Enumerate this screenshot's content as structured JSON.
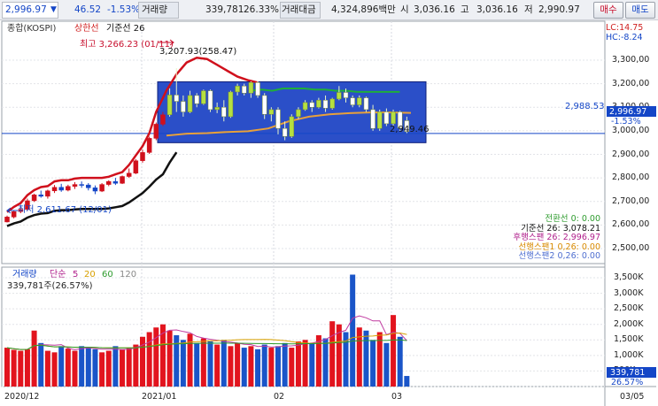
{
  "quote_bar": {
    "current": "2,996.97",
    "arrow": "▼",
    "change": "46.52",
    "change_pct": "-1.53%",
    "volume_label": "거래량",
    "volume": "339,781",
    "volume_ratio": "26.33%",
    "amount_label": "거래대금",
    "amount": "4,324,896백만",
    "open_label": "시",
    "open": "3,036.16",
    "high_label": "고",
    "high": "3,036.16",
    "low_label": "저",
    "low": "2,990.97",
    "buy_label": "매수",
    "sell_label": "매도"
  },
  "price_panel": {
    "title": "종합(KOSPI)",
    "indicator1": "상한선",
    "indicator2": "기준선 26",
    "lc": "LC:14.75",
    "hc": "HC:-8.24",
    "high_note": "최고 3,266.23 (01/11)",
    "low_note": "최저 2,611.67 (12/01)",
    "box_high": "3,207.93(258.47)",
    "box_low": "2,949.46",
    "ref_line": "2,988.53",
    "current_tag": "2,996.97",
    "current_pct": "-1.53%",
    "y_ticks": [
      "3,300,00",
      "3,200,00",
      "3,100,00",
      "3,000,00",
      "2,900,00",
      "2,800,00",
      "2,700,00",
      "2,600,00",
      "2,500,00"
    ]
  },
  "legend": [
    {
      "text": "전환선 0: 0.00",
      "color": "#2e9b2e"
    },
    {
      "text": "기준선 26: 3,078.21",
      "color": "#111111"
    },
    {
      "text": "후행스팬 26: 2,996.97",
      "color": "#b0208c"
    },
    {
      "text": "선행스팬1 0,26: 0.00",
      "color": "#d88a00"
    },
    {
      "text": "선행스팬2 0,26: 0.00",
      "color": "#4f6fd0"
    }
  ],
  "volume_panel": {
    "title": "거래량",
    "ma_label": "단순",
    "ma_periods": [
      {
        "text": "5",
        "color": "#b0208c"
      },
      {
        "text": "20",
        "color": "#d8a000"
      },
      {
        "text": "60",
        "color": "#2e9b2e"
      },
      {
        "text": "120",
        "color": "#888888"
      }
    ],
    "summary": "339,781주(26.57%)",
    "y_ticks": [
      "3,500K",
      "3,000K",
      "2,500K",
      "2,000K",
      "1,500K",
      "1,000K",
      "500K",
      "0"
    ],
    "current_tag": "339,781",
    "current_pct": "26.57%"
  },
  "x_axis": {
    "labels": [
      "2020/12",
      "2021/01",
      "02",
      "03"
    ],
    "right_label": "03/05"
  },
  "chart_data": {
    "type": "candlestick",
    "price_ylim": [
      2450,
      3330
    ],
    "volume_ylim": [
      0,
      3700
    ],
    "volume_unit": "K",
    "reference_line": 2988.53,
    "box": {
      "high": 3207.93,
      "low": 2949.46
    },
    "candles": [
      {
        "o": 2613,
        "h": 2640,
        "l": 2611,
        "c": 2634
      },
      {
        "o": 2634,
        "h": 2662,
        "l": 2628,
        "c": 2657
      },
      {
        "o": 2657,
        "h": 2678,
        "l": 2650,
        "c": 2666
      },
      {
        "o": 2666,
        "h": 2712,
        "l": 2660,
        "c": 2703
      },
      {
        "o": 2703,
        "h": 2733,
        "l": 2698,
        "c": 2728
      },
      {
        "o": 2728,
        "h": 2746,
        "l": 2716,
        "c": 2722
      },
      {
        "o": 2722,
        "h": 2750,
        "l": 2712,
        "c": 2745
      },
      {
        "o": 2745,
        "h": 2770,
        "l": 2736,
        "c": 2760
      },
      {
        "o": 2760,
        "h": 2775,
        "l": 2741,
        "c": 2748
      },
      {
        "o": 2748,
        "h": 2771,
        "l": 2743,
        "c": 2764
      },
      {
        "o": 2764,
        "h": 2782,
        "l": 2753,
        "c": 2772
      },
      {
        "o": 2772,
        "h": 2785,
        "l": 2758,
        "c": 2770
      },
      {
        "o": 2770,
        "h": 2778,
        "l": 2747,
        "c": 2758
      },
      {
        "o": 2758,
        "h": 2768,
        "l": 2731,
        "c": 2744
      },
      {
        "o": 2744,
        "h": 2778,
        "l": 2740,
        "c": 2772
      },
      {
        "o": 2772,
        "h": 2790,
        "l": 2765,
        "c": 2785
      },
      {
        "o": 2785,
        "h": 2800,
        "l": 2770,
        "c": 2777
      },
      {
        "o": 2777,
        "h": 2810,
        "l": 2774,
        "c": 2806
      },
      {
        "o": 2806,
        "h": 2840,
        "l": 2800,
        "c": 2820
      },
      {
        "o": 2820,
        "h": 2880,
        "l": 2816,
        "c": 2873
      },
      {
        "o": 2873,
        "h": 2920,
        "l": 2865,
        "c": 2908
      },
      {
        "o": 2908,
        "h": 2975,
        "l": 2902,
        "c": 2968
      },
      {
        "o": 2968,
        "h": 3035,
        "l": 2960,
        "c": 3028
      },
      {
        "o": 3028,
        "h": 3080,
        "l": 3020,
        "c": 3068
      },
      {
        "o": 3068,
        "h": 3180,
        "l": 3060,
        "c": 3152
      },
      {
        "o": 3152,
        "h": 3266,
        "l": 3080,
        "c": 3125
      },
      {
        "o": 3125,
        "h": 3150,
        "l": 3060,
        "c": 3080
      },
      {
        "o": 3080,
        "h": 3170,
        "l": 3075,
        "c": 3150
      },
      {
        "o": 3150,
        "h": 3160,
        "l": 3100,
        "c": 3115
      },
      {
        "o": 3115,
        "h": 3175,
        "l": 3110,
        "c": 3170
      },
      {
        "o": 3170,
        "h": 3175,
        "l": 3080,
        "c": 3090
      },
      {
        "o": 3090,
        "h": 3120,
        "l": 3075,
        "c": 3100
      },
      {
        "o": 3100,
        "h": 3130,
        "l": 3040,
        "c": 3060
      },
      {
        "o": 3060,
        "h": 3170,
        "l": 3055,
        "c": 3165
      },
      {
        "o": 3165,
        "h": 3200,
        "l": 3150,
        "c": 3190
      },
      {
        "o": 3190,
        "h": 3200,
        "l": 3150,
        "c": 3160
      },
      {
        "o": 3160,
        "h": 3210,
        "l": 3140,
        "c": 3205
      },
      {
        "o": 3205,
        "h": 3210,
        "l": 3140,
        "c": 3150
      },
      {
        "o": 3150,
        "h": 3160,
        "l": 3050,
        "c": 3070
      },
      {
        "o": 3070,
        "h": 3100,
        "l": 3040,
        "c": 3090
      },
      {
        "o": 3090,
        "h": 3100,
        "l": 2985,
        "c": 3010
      },
      {
        "o": 3010,
        "h": 3040,
        "l": 2960,
        "c": 2976
      },
      {
        "o": 2976,
        "h": 3070,
        "l": 2970,
        "c": 3060
      },
      {
        "o": 3060,
        "h": 3100,
        "l": 3050,
        "c": 3090
      },
      {
        "o": 3090,
        "h": 3130,
        "l": 3085,
        "c": 3120
      },
      {
        "o": 3120,
        "h": 3130,
        "l": 3080,
        "c": 3100
      },
      {
        "o": 3100,
        "h": 3140,
        "l": 3095,
        "c": 3130
      },
      {
        "o": 3130,
        "h": 3150,
        "l": 3080,
        "c": 3096
      },
      {
        "o": 3096,
        "h": 3140,
        "l": 3090,
        "c": 3135
      },
      {
        "o": 3135,
        "h": 3190,
        "l": 3130,
        "c": 3163
      },
      {
        "o": 3163,
        "h": 3180,
        "l": 3120,
        "c": 3140
      },
      {
        "o": 3140,
        "h": 3150,
        "l": 3100,
        "c": 3110
      },
      {
        "o": 3110,
        "h": 3150,
        "l": 3100,
        "c": 3140
      },
      {
        "o": 3140,
        "h": 3145,
        "l": 3080,
        "c": 3090
      },
      {
        "o": 3090,
        "h": 3110,
        "l": 3000,
        "c": 3010
      },
      {
        "o": 3010,
        "h": 3090,
        "l": 3000,
        "c": 3080
      },
      {
        "o": 3080,
        "h": 3095,
        "l": 3020,
        "c": 3030
      },
      {
        "o": 3030,
        "h": 3090,
        "l": 3020,
        "c": 3080
      },
      {
        "o": 3080,
        "h": 3085,
        "l": 3000,
        "c": 3012
      },
      {
        "o": 3043,
        "h": 3060,
        "l": 2990,
        "c": 2997
      }
    ],
    "volumes": [
      1250,
      1180,
      1150,
      1200,
      1800,
      1400,
      1150,
      1100,
      1300,
      1220,
      1150,
      1300,
      1250,
      1200,
      1100,
      1150,
      1300,
      1200,
      1250,
      1350,
      1600,
      1750,
      1900,
      2000,
      1800,
      1650,
      1500,
      1700,
      1400,
      1550,
      1450,
      1350,
      1500,
      1300,
      1400,
      1250,
      1300,
      1200,
      1350,
      1250,
      1300,
      1400,
      1250,
      1450,
      1500,
      1400,
      1650,
      1550,
      2100,
      2000,
      1750,
      3600,
      1900,
      1800,
      1500,
      1750,
      1400,
      2300,
      1600,
      340
    ],
    "lines": {
      "senkou_span_2": [
        3170,
        3175,
        3170,
        3180,
        3180,
        3180,
        3175,
        3175,
        3170,
        3170,
        3165,
        3165,
        3165,
        3165,
        3165
      ],
      "kijun_base": [
        2988,
        3010,
        3050,
        3060,
        3070,
        3078
      ]
    },
    "x_ticks": [
      "2020/12",
      "2021/01",
      "02",
      "03"
    ]
  }
}
